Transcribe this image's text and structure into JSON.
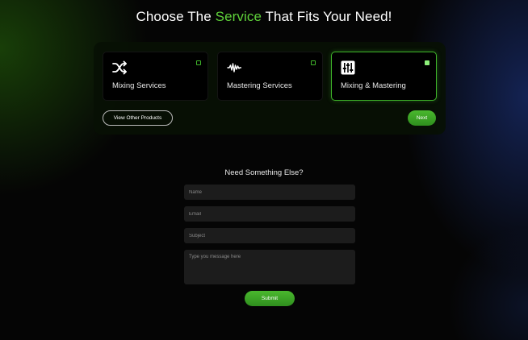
{
  "header": {
    "title_prefix": "Choose The ",
    "title_accent": "Service",
    "title_suffix": " That Fits Your Need!",
    "accent_color": "#5fd13a"
  },
  "services": [
    {
      "label": "Mixing Services",
      "icon": "shuffle-icon",
      "selected": false
    },
    {
      "label": "Mastering Services",
      "icon": "waveform-icon",
      "selected": false
    },
    {
      "label": "Mixing & Mastering",
      "icon": "mixer-sliders-icon",
      "selected": true
    }
  ],
  "actions": {
    "other_products_label": "View Other Products",
    "next_label": "Next"
  },
  "contact": {
    "title": "Need Something Else?",
    "name_placeholder": "Name",
    "email_placeholder": "Email",
    "subject_placeholder": "Subject",
    "message_placeholder": "Type you message here",
    "submit_label": "Submit"
  }
}
